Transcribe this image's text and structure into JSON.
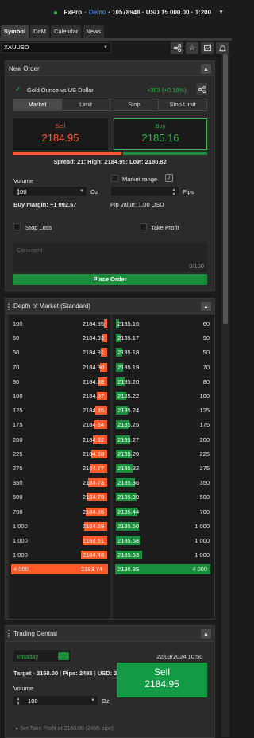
{
  "account": {
    "broker": "FxPro",
    "separator": "·",
    "mode": "Demo",
    "summary": "· 10578948 · USD 15 000.00 · 1:200"
  },
  "tabs": [
    "Symbol",
    "DoM",
    "Calendar",
    "News"
  ],
  "symbol": "XAUUSD",
  "new_order": {
    "title": "New Order",
    "instrument": "Gold Ounce vs US Dollar",
    "change": "+383 (+0.18%)",
    "order_types": [
      "Market",
      "Limit",
      "Stop",
      "Stop Limit"
    ],
    "sell_label": "Sell",
    "sell_price": "2184.95",
    "buy_label": "Buy",
    "buy_price": "2185.16",
    "spread_info": "Spread: 21; High: 2184.95; Low: 2180.82",
    "volume_label": "Volume",
    "volume_value": "100",
    "volume_unit": "Oz",
    "market_range_label": "Market range",
    "pips_label": "Pips",
    "buy_margin": "Buy margin: ~1 092.57",
    "pip_value": "Pip value: 1.00 USD",
    "stop_loss_label": "Stop Loss",
    "take_profit_label": "Take Profit",
    "comment_placeholder": "Comment",
    "comment_count": "0/100",
    "place_order_label": "Place Order"
  },
  "depth_of_market": {
    "title": "Depth of Market (Standard)",
    "bids": [
      {
        "volume": "100",
        "price": "2184.95"
      },
      {
        "volume": "50",
        "price": "2184.93"
      },
      {
        "volume": "50",
        "price": "2184.91"
      },
      {
        "volume": "70",
        "price": "2184.90"
      },
      {
        "volume": "80",
        "price": "2184.88"
      },
      {
        "volume": "100",
        "price": "2184.87"
      },
      {
        "volume": "125",
        "price": "2184.85"
      },
      {
        "volume": "175",
        "price": "2184.84"
      },
      {
        "volume": "200",
        "price": "2184.82"
      },
      {
        "volume": "225",
        "price": "2184.80"
      },
      {
        "volume": "275",
        "price": "2184.77"
      },
      {
        "volume": "350",
        "price": "2184.73"
      },
      {
        "volume": "500",
        "price": "2184.70"
      },
      {
        "volume": "700",
        "price": "2184.65"
      },
      {
        "volume": "1 000",
        "price": "2184.59"
      },
      {
        "volume": "1 000",
        "price": "2184.51"
      },
      {
        "volume": "1 000",
        "price": "2184.48"
      },
      {
        "volume": "4 000",
        "price": "2183.74"
      }
    ],
    "asks": [
      {
        "price": "2185.16",
        "volume": "60"
      },
      {
        "price": "2185.17",
        "volume": "90"
      },
      {
        "price": "2185.18",
        "volume": "50"
      },
      {
        "price": "2185.19",
        "volume": "70"
      },
      {
        "price": "2185.20",
        "volume": "80"
      },
      {
        "price": "2185.22",
        "volume": "100"
      },
      {
        "price": "2185.24",
        "volume": "125"
      },
      {
        "price": "2185.25",
        "volume": "175"
      },
      {
        "price": "2185.27",
        "volume": "200"
      },
      {
        "price": "2185.29",
        "volume": "225"
      },
      {
        "price": "2185.32",
        "volume": "275"
      },
      {
        "price": "2185.36",
        "volume": "350"
      },
      {
        "price": "2185.39",
        "volume": "500"
      },
      {
        "price": "2185.44",
        "volume": "700"
      },
      {
        "price": "2185.50",
        "volume": "1 000"
      },
      {
        "price": "2185.58",
        "volume": "1 000"
      },
      {
        "price": "2185.63",
        "volume": "1 000"
      },
      {
        "price": "2186.35",
        "volume": "4 000"
      }
    ]
  },
  "trading_central": {
    "title": "Trading Central",
    "timeframe": "Intraday",
    "datetime": "22/03/2024 10:50",
    "target": "Target - 2160.00",
    "pips": "Pips: 2495",
    "usd": "USD: 2 495.00",
    "volume_label": "Volume",
    "volume_value": "100",
    "volume_unit": "Oz",
    "sell_label": "Sell",
    "sell_price": "2184.95",
    "take_profit_hint": "Set Take Profit at 2160.00 (2495 pips)"
  },
  "colors": {
    "sell": "#ff5a2a",
    "buy": "#1a8e3c",
    "accent_green": "#2eb44b",
    "panel": "#2b2b2b",
    "background": "#1b1b1b"
  }
}
